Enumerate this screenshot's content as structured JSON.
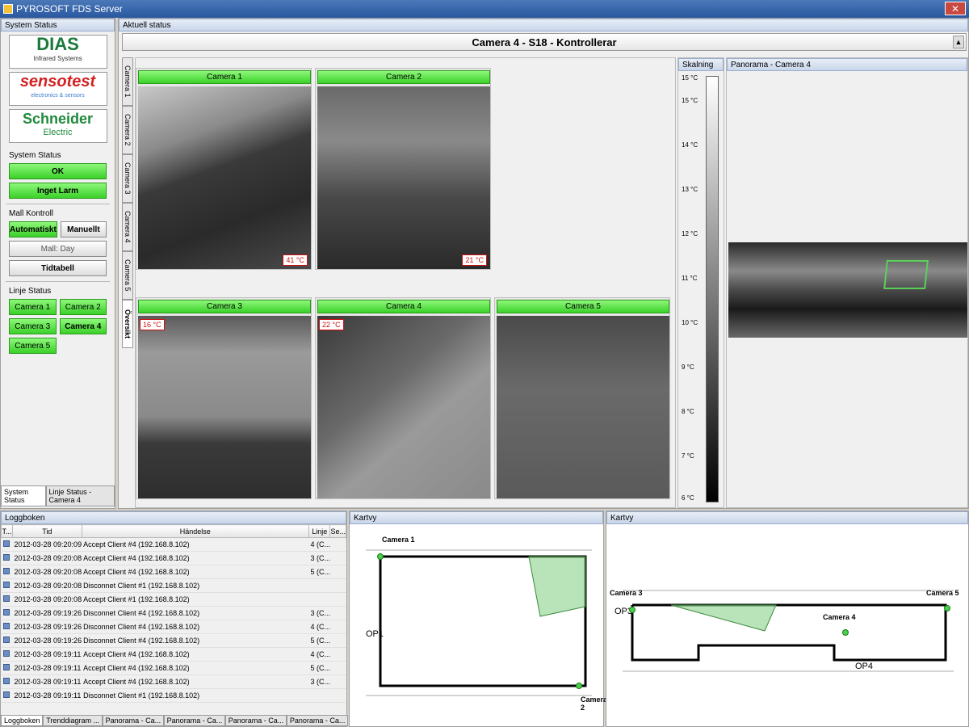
{
  "window": {
    "title": "PYROSOFT FDS Server",
    "close": "✕"
  },
  "left": {
    "header": "System Status",
    "logos": {
      "dias": "DIAS",
      "dias_sub": "Infrared Systems",
      "senso": "sensotest",
      "senso_sub": "electronics & sensors",
      "schneider": "Schneider",
      "schneider_sub": "Electric"
    },
    "system_status_label": "System Status",
    "status_ok": "OK",
    "status_alarm": "Inget Larm",
    "mall_label": "Mall Kontroll",
    "auto": "Automatiskt",
    "manual": "Manuellt",
    "mall_day": "Mall: Day",
    "schedule": "Tidtabell",
    "line_label": "Linje Status",
    "cameras": [
      "Camera 1",
      "Camera 2",
      "Camera 3",
      "Camera 4",
      "Camera 5"
    ],
    "tabs": [
      "System Status",
      "Linje Status - Camera 4"
    ]
  },
  "center": {
    "header": "Aktuell status",
    "title": "Camera 4 - S18 - Kontrollerar",
    "vtabs": [
      "Camera 1",
      "Camera 2",
      "Camera 3",
      "Camera 4",
      "Camera 5",
      "Översikt"
    ],
    "cams": [
      {
        "name": "Camera 1",
        "temp": "41 °C"
      },
      {
        "name": "Camera 2",
        "temp": "21 °C"
      },
      {
        "name": "Camera 3",
        "temp": "16 °C"
      },
      {
        "name": "Camera 4",
        "temp": "22 °C"
      },
      {
        "name": "Camera 5",
        "temp": ""
      }
    ],
    "scale_header": "Skalning",
    "scale_ticks": [
      "15 °C",
      "15 °C",
      "14 °C",
      "13 °C",
      "12 °C",
      "11 °C",
      "10 °C",
      "9 °C",
      "8 °C",
      "7 °C",
      "6 °C"
    ],
    "panorama_header": "Panorama - Camera 4"
  },
  "log": {
    "header": "Loggboken",
    "cols": [
      "T...",
      "Tid",
      "Händelse",
      "Linje",
      "Se..."
    ],
    "rows": [
      {
        "time": "2012-03-28 09:20:09",
        "event": "Accept Client #4 (192.168.8.102)",
        "line": "4 (C..."
      },
      {
        "time": "2012-03-28 09:20:08",
        "event": "Accept Client #4 (192.168.8.102)",
        "line": "3 (C..."
      },
      {
        "time": "2012-03-28 09:20:08",
        "event": "Accept Client #4 (192.168.8.102)",
        "line": "5 (C..."
      },
      {
        "time": "2012-03-28 09:20:08",
        "event": "Disconnet Client #1 (192.168.8.102)",
        "line": ""
      },
      {
        "time": "2012-03-28 09:20:08",
        "event": "Accept Client #1 (192.168.8.102)",
        "line": ""
      },
      {
        "time": "2012-03-28 09:19:26",
        "event": "Disconnet Client #4 (192.168.8.102)",
        "line": "3 (C..."
      },
      {
        "time": "2012-03-28 09:19:26",
        "event": "Disconnet Client #4 (192.168.8.102)",
        "line": "4 (C..."
      },
      {
        "time": "2012-03-28 09:19:26",
        "event": "Disconnet Client #4 (192.168.8.102)",
        "line": "5 (C..."
      },
      {
        "time": "2012-03-28 09:19:11",
        "event": "Accept Client #4 (192.168.8.102)",
        "line": "4 (C..."
      },
      {
        "time": "2012-03-28 09:19:11",
        "event": "Accept Client #4 (192.168.8.102)",
        "line": "5 (C..."
      },
      {
        "time": "2012-03-28 09:19:11",
        "event": "Accept Client #4 (192.168.8.102)",
        "line": "3 (C..."
      },
      {
        "time": "2012-03-28 09:19:11",
        "event": "Disconnet Client #1 (192.168.8.102)",
        "line": ""
      }
    ],
    "tabs": [
      "Loggboken",
      "Trenddiagram ...",
      "Panorama - Ca...",
      "Panorama - Ca...",
      "Panorama - Ca...",
      "Panorama - Ca..."
    ]
  },
  "map1": {
    "header": "Kartvy",
    "cam1": "Camera 1",
    "cam2": "Camera 2",
    "op1": "OP1"
  },
  "map2": {
    "header": "Kartvy",
    "cam3": "Camera 3",
    "cam4": "Camera 4",
    "cam5": "Camera 5",
    "op3": "OP3",
    "op4": "OP4"
  }
}
